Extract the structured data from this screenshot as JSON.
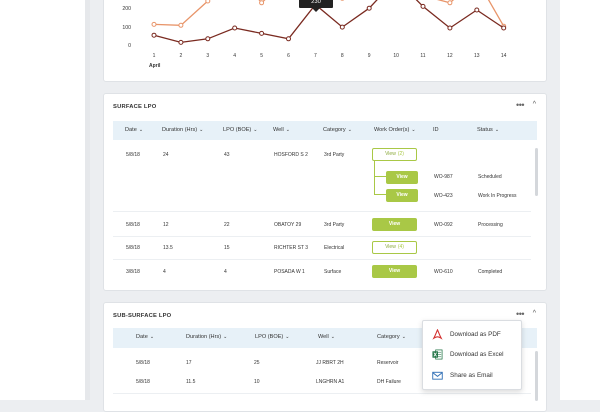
{
  "chart_data": {
    "type": "line",
    "x": [
      1,
      2,
      3,
      4,
      5,
      6,
      7,
      8,
      9,
      10,
      11,
      12,
      13,
      14
    ],
    "xlabel": "April",
    "y_ticks": [
      0,
      100,
      200
    ],
    "series": [
      {
        "color": "#e8956a",
        "values": [
          120,
          115,
          250,
          420,
          240,
          380,
          350,
          265,
          410,
          420,
          280,
          240,
          370,
          110
        ]
      },
      {
        "color": "#7a2a20",
        "values": [
          60,
          20,
          40,
          100,
          70,
          40,
          230,
          105,
          210,
          370,
          220,
          100,
          200,
          100
        ]
      }
    ],
    "highlight": {
      "x": 7,
      "label": "230"
    },
    "ylim": [
      0,
      300
    ],
    "grid": false
  },
  "surface": {
    "title": "SURFACE LPO",
    "columns": [
      "Date",
      "Duration (Hrs)",
      "LPO (BOE)",
      "Well",
      "Category",
      "Work Order(s)",
      "ID",
      "Status"
    ],
    "rows": [
      {
        "date": "5/8/18",
        "duration": "24",
        "lpo": "43",
        "well": "HOSFORD S 2",
        "category": "3rd Party",
        "button": "View",
        "count": "(2)",
        "children": [
          {
            "button": "View",
            "id": "WO-987",
            "status": "Scheduled"
          },
          {
            "button": "View",
            "id": "WO-423",
            "status": "Work In Progress"
          }
        ]
      },
      {
        "date": "5/8/18",
        "duration": "12",
        "lpo": "22",
        "well": "OBATOY 29",
        "category": "3rd Party",
        "button": "View",
        "id": "WO-092",
        "status": "Processing"
      },
      {
        "date": "5/8/18",
        "duration": "13.5",
        "lpo": "15",
        "well": "RICHTER ST 3",
        "category": "Electrical",
        "button": "View",
        "count": "(4)"
      },
      {
        "date": "3/8/18",
        "duration": "4",
        "lpo": "4",
        "well": "POSADA W 1",
        "category": "Surface",
        "button": "View",
        "id": "WO-610",
        "status": "Completed"
      }
    ]
  },
  "subsurface": {
    "title": "SUB-SURFACE LPO",
    "columns": [
      "Date",
      "Duration (Hrs)",
      "LPO (BOE)",
      "Well",
      "Category"
    ],
    "rows": [
      {
        "date": "5/8/18",
        "duration": "17",
        "lpo": "25",
        "well": "JJ RBRT 2H",
        "category": "Reservoir"
      },
      {
        "date": "5/8/18",
        "duration": "11.5",
        "lpo": "10",
        "well": "LNGHRN A1",
        "category": "DH Failure"
      }
    ]
  },
  "menu": {
    "items": [
      {
        "label": "Download as PDF",
        "icon": "pdf-icon",
        "color": "#d3302f"
      },
      {
        "label": "Download as Excel",
        "icon": "excel-icon",
        "color": "#1f7244"
      },
      {
        "label": "Share as Email",
        "icon": "email-icon",
        "color": "#2f6fb5"
      }
    ]
  },
  "card_menu_dots": "•••",
  "caret": "^"
}
